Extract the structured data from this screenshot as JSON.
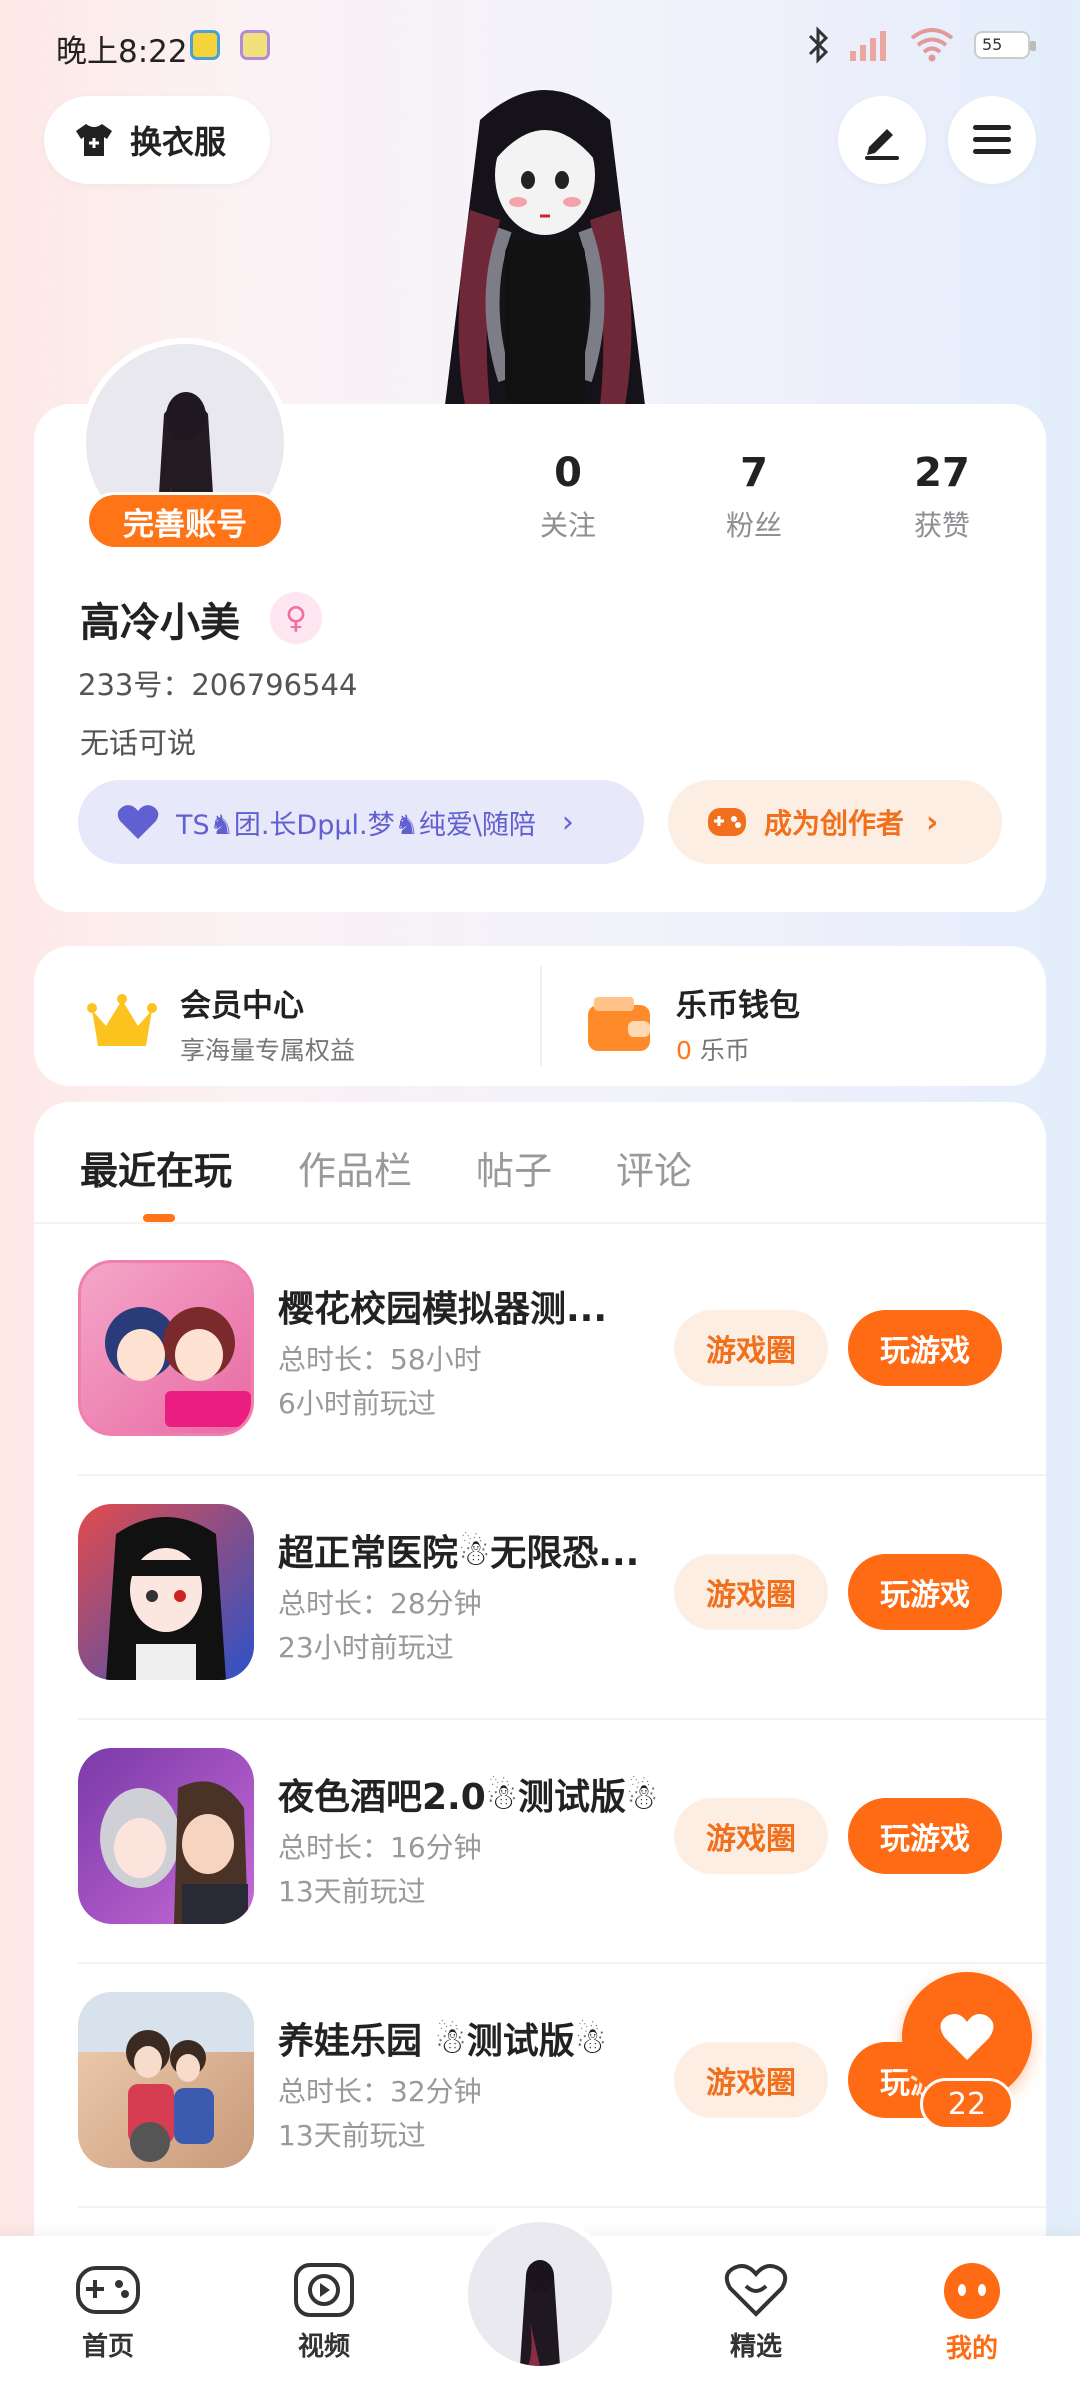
{
  "status_bar": {
    "time": "晚上8:22",
    "battery": "55"
  },
  "header": {
    "wardrobe_label": "换衣服"
  },
  "profile": {
    "complete_label": "完善账号",
    "stats": [
      {
        "value": "0",
        "label": "关注"
      },
      {
        "value": "7",
        "label": "粉丝"
      },
      {
        "value": "27",
        "label": "获赞"
      }
    ],
    "name": "高冷小美",
    "gender_symbol": "♀",
    "id_line": "233号：206796544",
    "bio": "无话可说",
    "group_label": "TS♞团.长Dpμl.梦♞纯爱\\随陪",
    "creator_label": "成为创作者"
  },
  "member": {
    "vip_title": "会员中心",
    "vip_sub": "享海量专属权益",
    "wallet_title": "乐币钱包",
    "wallet_amount": "0",
    "wallet_unit": "乐币"
  },
  "tabs": [
    "最近在玩",
    "作品栏",
    "帖子",
    "评论"
  ],
  "games": [
    {
      "title": "樱花校园模拟器测...",
      "duration": "总时长：58小时",
      "ago": "6小时前玩过",
      "circle": "游戏圈",
      "play": "玩游戏"
    },
    {
      "title": "超正常医院☃无限恐...",
      "duration": "总时长：28分钟",
      "ago": "23小时前玩过",
      "circle": "游戏圈",
      "play": "玩游戏"
    },
    {
      "title": "夜色酒吧2.0☃测试版☃",
      "duration": "总时长：16分钟",
      "ago": "13天前玩过",
      "circle": "游戏圈",
      "play": "玩游戏"
    },
    {
      "title": "养娃乐园 ☃测试版☃",
      "duration": "总时长：32分钟",
      "ago": "13天前玩过",
      "circle": "游戏圈",
      "play": "玩游戏"
    }
  ],
  "like_count": "22",
  "bottom_nav": [
    {
      "label": "首页"
    },
    {
      "label": "视频"
    },
    {
      "label": "精选"
    },
    {
      "label": "我的"
    }
  ],
  "colors": {
    "accent": "#ff6a14",
    "accent_light": "#fdeee4",
    "purple": "#6160d0",
    "purple_light": "#e8e8fb"
  }
}
